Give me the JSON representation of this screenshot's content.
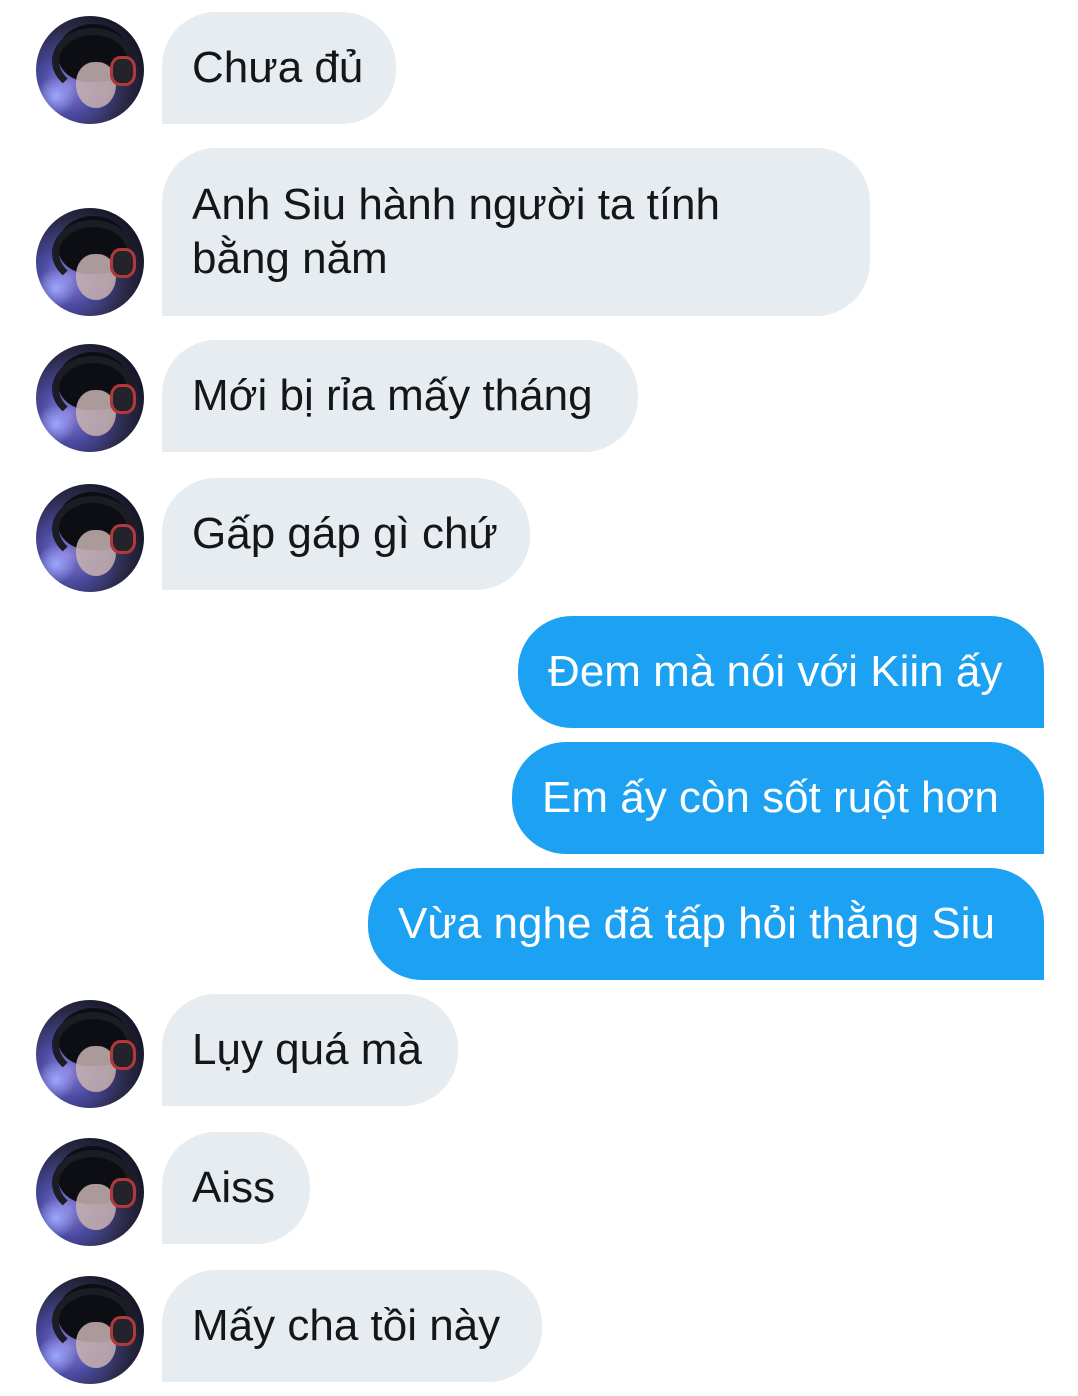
{
  "conversation": {
    "messages": [
      {
        "direction": "in",
        "text": "Chưa đủ"
      },
      {
        "direction": "in",
        "text": "Anh Siu hành người ta tính\nbằng năm"
      },
      {
        "direction": "in",
        "text": "Mới bị rỉa mấy tháng"
      },
      {
        "direction": "in",
        "text": "Gấp gáp gì chứ"
      },
      {
        "direction": "out",
        "text": "Đem mà nói với Kiin ấy"
      },
      {
        "direction": "out",
        "text": "Em ấy còn sốt ruột hơn"
      },
      {
        "direction": "out",
        "text": "Vừa nghe đã tấp hỏi thằng Siu"
      },
      {
        "direction": "in",
        "text": "Lụy quá mà"
      },
      {
        "direction": "in",
        "text": "Aiss"
      },
      {
        "direction": "in",
        "text": "Mấy cha tồi này"
      }
    ]
  },
  "colors": {
    "incoming_bubble": "#e6ecf0",
    "outgoing_bubble": "#1da1f2",
    "incoming_text": "#14171a",
    "outgoing_text": "#ffffff"
  },
  "icons": {
    "avatar": "user-avatar-photo"
  }
}
